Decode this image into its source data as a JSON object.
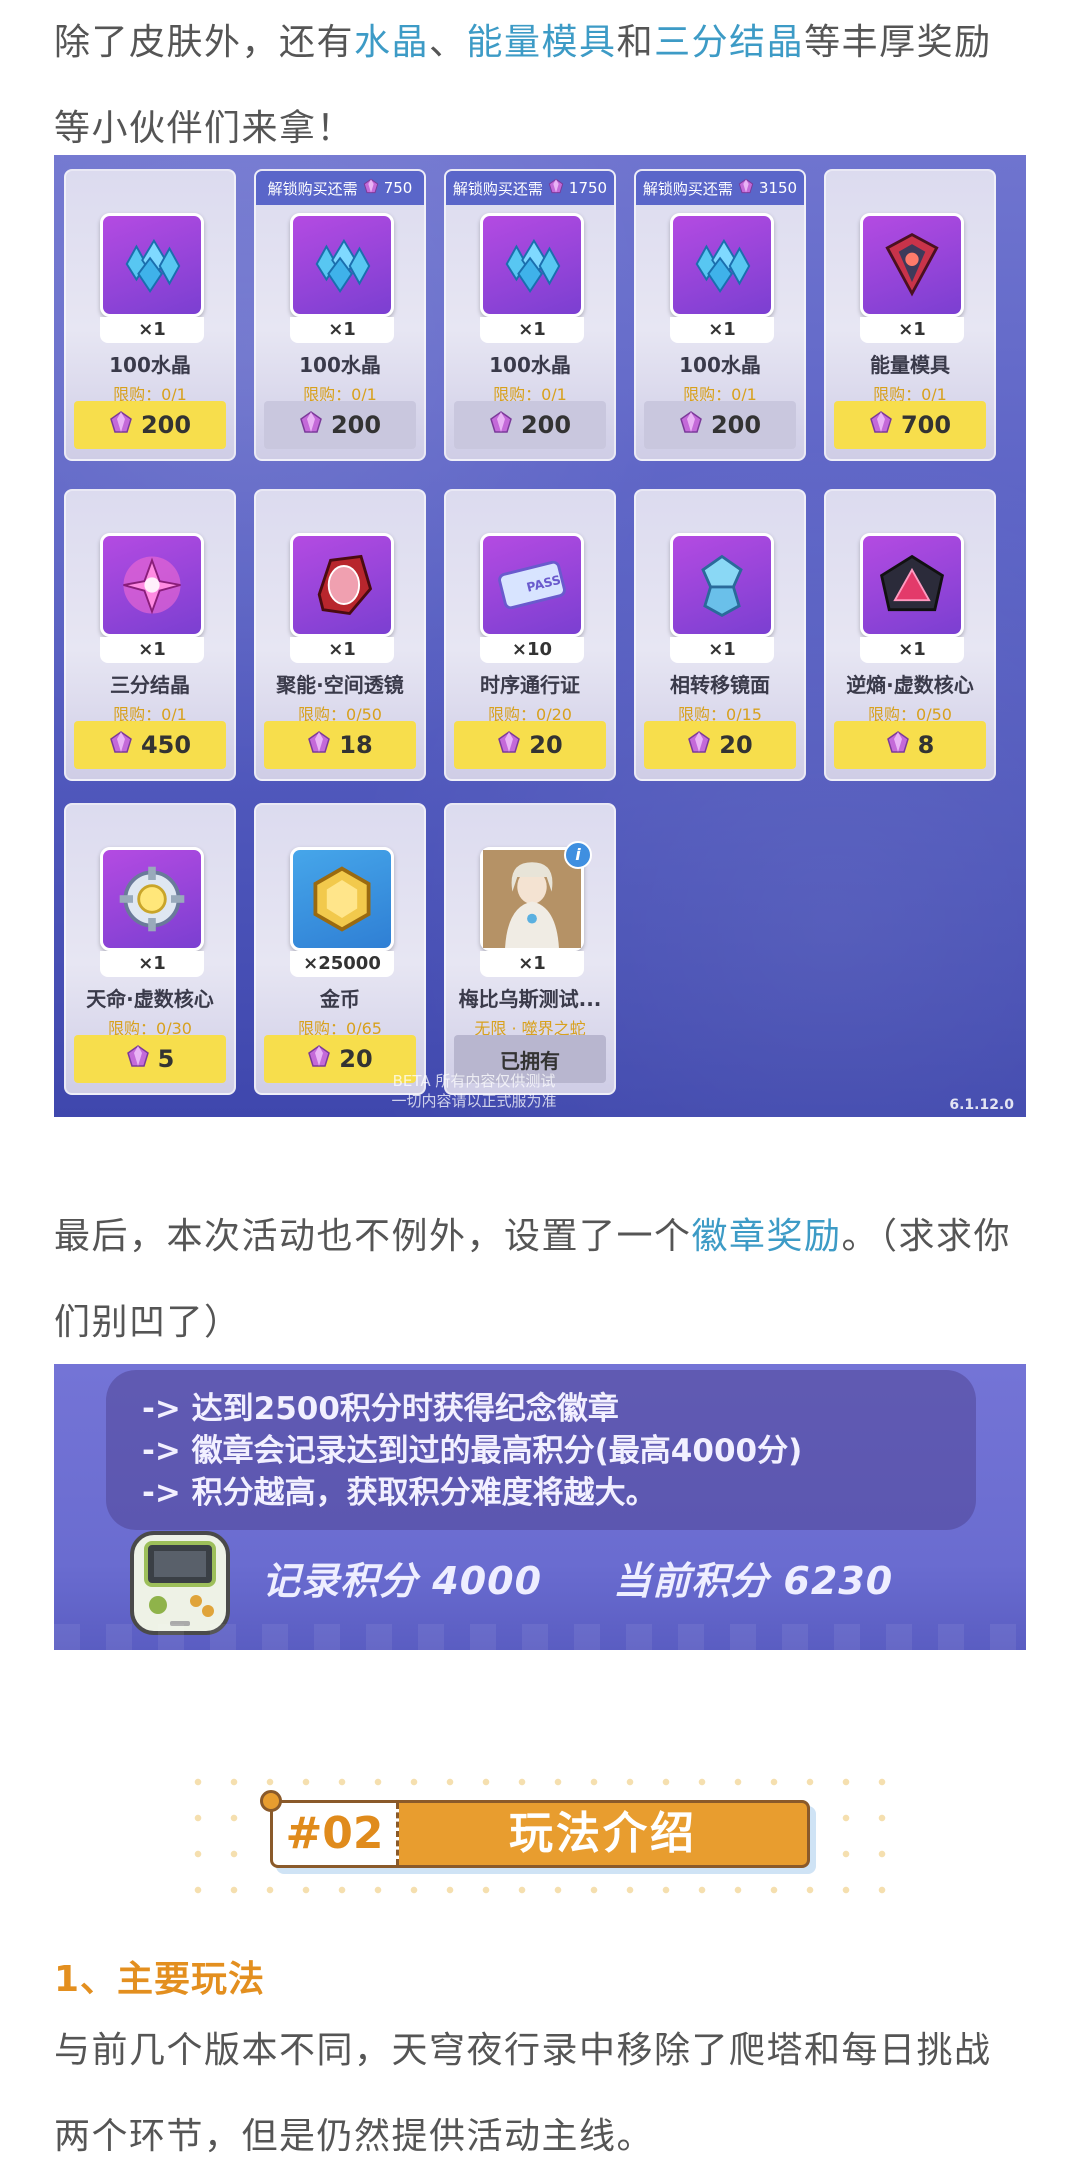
{
  "intro": {
    "prefix": "除了皮肤外，还有",
    "hl1": "水晶",
    "sep1": "、",
    "hl2": "能量模具",
    "sep2": "和",
    "hl3": "三分结晶",
    "suffix": "等丰厚奖励等小伙伴们来拿！"
  },
  "shop": {
    "unlock_label": "解锁购买还需",
    "items": [
      {
        "name": "100水晶",
        "qty": "×1",
        "limit": "限购：0/1",
        "price": "200",
        "unlock": "",
        "price_style": "gold",
        "icon": "crystal-icon"
      },
      {
        "name": "100水晶",
        "qty": "×1",
        "limit": "限购：0/1",
        "price": "200",
        "unlock": "750",
        "price_style": "dim",
        "icon": "crystal-icon"
      },
      {
        "name": "100水晶",
        "qty": "×1",
        "limit": "限购：0/1",
        "price": "200",
        "unlock": "1750",
        "price_style": "dim",
        "icon": "crystal-icon"
      },
      {
        "name": "100水晶",
        "qty": "×1",
        "limit": "限购：0/1",
        "price": "200",
        "unlock": "3150",
        "price_style": "dim",
        "icon": "crystal-icon"
      },
      {
        "name": "能量模具",
        "qty": "×1",
        "limit": "限购：0/1",
        "price": "700",
        "unlock": "",
        "price_style": "gold",
        "icon": "energy-mold-icon"
      },
      {
        "name": "三分结晶",
        "qty": "×1",
        "limit": "限购：0/1",
        "price": "450",
        "unlock": "",
        "price_style": "gold",
        "icon": "tri-crystal-icon"
      },
      {
        "name": "聚能·空间透镜",
        "qty": "×1",
        "limit": "限购：0/50",
        "price": "18",
        "unlock": "",
        "price_style": "gold",
        "icon": "space-lens-icon"
      },
      {
        "name": "时序通行证",
        "qty": "×10",
        "limit": "限购：0/20",
        "price": "20",
        "unlock": "",
        "price_style": "gold",
        "icon": "pass-ticket-icon"
      },
      {
        "name": "相转移镜面",
        "qty": "×1",
        "limit": "限购：0/15",
        "price": "20",
        "unlock": "",
        "price_style": "gold",
        "icon": "phase-mirror-icon"
      },
      {
        "name": "逆熵·虚数核心",
        "qty": "×1",
        "limit": "限购：0/50",
        "price": "8",
        "unlock": "",
        "price_style": "gold",
        "icon": "core-triangle-icon"
      },
      {
        "name": "天命·虚数核心",
        "qty": "×1",
        "limit": "限购：0/30",
        "price": "5",
        "unlock": "",
        "price_style": "gold",
        "icon": "core-ring-icon"
      },
      {
        "name": "金币",
        "qty": "×25000",
        "limit": "限购：0/65",
        "price": "20",
        "unlock": "",
        "price_style": "gold",
        "icon": "coin-icon"
      },
      {
        "name": "梅比乌斯测试...",
        "qty": "×1",
        "limit": "无限 · 噬界之蛇",
        "price": "已拥有",
        "unlock": "",
        "price_style": "owned",
        "icon": "portrait-icon"
      }
    ],
    "beta_line1": "BETA 所有内容仅供测试",
    "beta_line2": "一切内容请以正式服为准",
    "version": "6.1.12.0"
  },
  "badge_intro": {
    "prefix": "最后，本次活动也不例外，设置了一个",
    "hl": "徽章奖励",
    "suffix": "。（求求你们别凹了）"
  },
  "badge": {
    "lines": [
      "-> 达到2500积分时获得纪念徽章",
      "-> 徽章会记录达到过的最高积分(最高4000分)",
      "-> 积分越高，获取积分难度将越大。"
    ],
    "record_label": "记录积分",
    "record_value": "4000",
    "current_label": "当前积分",
    "current_value": "6230"
  },
  "section": {
    "number": "#02",
    "title": "玩法介绍"
  },
  "heading": "1、主要玩法",
  "body": "与前几个版本不同，天穹夜行录中移除了爬塔和每日挑战两个环节，但是仍然提供活动主线。",
  "colors": {
    "highlight": "#3d9bc6",
    "accent": "#e38f1f",
    "price_gold": "#f7de4c"
  }
}
